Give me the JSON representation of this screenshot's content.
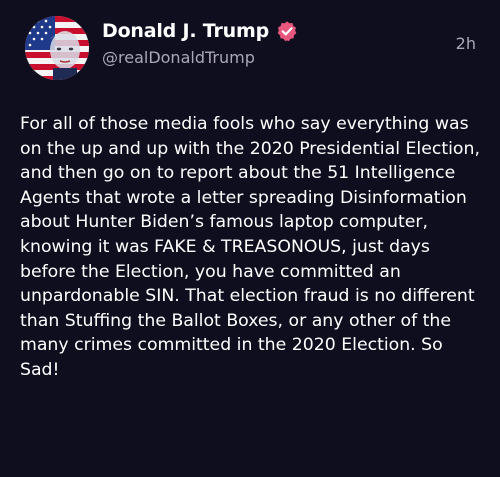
{
  "post": {
    "author": {
      "display_name": "Donald J. Trump",
      "handle": "@realDonaldTrump",
      "verified": true,
      "avatar_icon": "avatar-flag-portrait"
    },
    "timestamp": "2h",
    "text": "For all of those media fools who say everything was on the up and up with the 2020 Presidential Election, and then go on to report about the 51 Intelligence Agents that wrote a letter spreading Disinformation about Hunter Biden’s famous laptop computer, knowing it was FAKE & TREASONOUS, just days before the Election, you have committed an unpardonable SIN. That election fraud is no different than Stuffing the Ballot Boxes, or any other of the many crimes committed in the 2020 Election. So Sad!"
  },
  "colors": {
    "background": "#0f0e1f",
    "text_primary": "#ffffff",
    "text_secondary": "#a9a7b8",
    "verified_badge": "#e8577e"
  },
  "icons": {
    "verified": "verified-badge-icon"
  }
}
